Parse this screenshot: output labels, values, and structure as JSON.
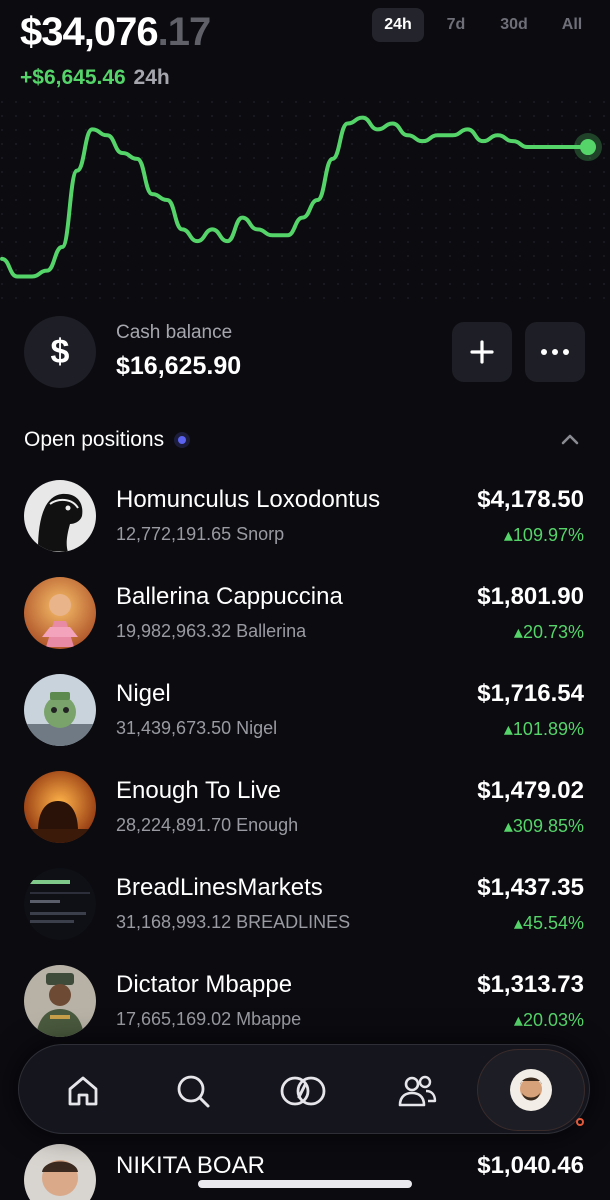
{
  "header": {
    "balance_main": "$34,076",
    "balance_cents": ".17",
    "change_value": "+$6,645.46",
    "change_period": "24h",
    "ranges": [
      "24h",
      "7d",
      "30d",
      "All"
    ],
    "active_range": "24h"
  },
  "chart_data": {
    "type": "line",
    "title": "",
    "xlabel": "",
    "ylabel": "",
    "grid": false,
    "line_color": "#55d46a",
    "x": [
      0,
      1,
      2,
      3,
      4,
      5,
      6,
      7,
      8,
      9,
      10,
      11,
      12,
      13,
      14,
      15,
      16,
      17,
      18,
      19,
      20,
      21,
      22,
      23,
      24,
      25,
      26,
      27,
      28,
      29,
      30,
      31,
      32,
      33,
      34,
      35,
      36,
      37,
      38,
      39
    ],
    "values": [
      17,
      14,
      14,
      15,
      19,
      32,
      39,
      38,
      35,
      34,
      28,
      27,
      22,
      20,
      22,
      20,
      24,
      22,
      21,
      21,
      24,
      27,
      34,
      40,
      41,
      39,
      40,
      38,
      37,
      38,
      38,
      39,
      37,
      38,
      37,
      36,
      36,
      36,
      36,
      36
    ],
    "ylim": [
      10,
      44
    ]
  },
  "cash": {
    "icon": "$",
    "label": "Cash balance",
    "value": "$16,625.90"
  },
  "positions": {
    "title": "Open positions",
    "items": [
      {
        "name": "Homunculus Loxodontus",
        "qty": "12,772,191.65 Snorp",
        "price": "$4,178.50",
        "pct": "▴109.97%"
      },
      {
        "name": "Ballerina Cappuccina",
        "qty": "19,982,963.32 Ballerina",
        "price": "$1,801.90",
        "pct": "▴20.73%"
      },
      {
        "name": "Nigel",
        "qty": "31,439,673.50 Nigel",
        "price": "$1,716.54",
        "pct": "▴101.89%"
      },
      {
        "name": "Enough To Live",
        "qty": "28,224,891.70 Enough",
        "price": "$1,479.02",
        "pct": "▴309.85%"
      },
      {
        "name": "BreadLinesMarkets",
        "qty": "31,168,993.12 BREADLINES",
        "price": "$1,437.35",
        "pct": "▴45.54%"
      },
      {
        "name": "Dictator Mbappe",
        "qty": "17,665,169.02 Mbappe",
        "price": "$1,313.73",
        "pct": "▴20.03%"
      },
      {
        "name": "NIKITA BOAR",
        "qty": "",
        "price": "$1,040.46",
        "pct": ""
      }
    ]
  },
  "nav": {
    "items": [
      "home-icon",
      "search-icon",
      "trade-icon",
      "people-icon",
      "profile-icon"
    ]
  },
  "colors": {
    "background": "#0b0b10",
    "positive": "#55d46a",
    "accent_dot": "#5b63f0"
  }
}
